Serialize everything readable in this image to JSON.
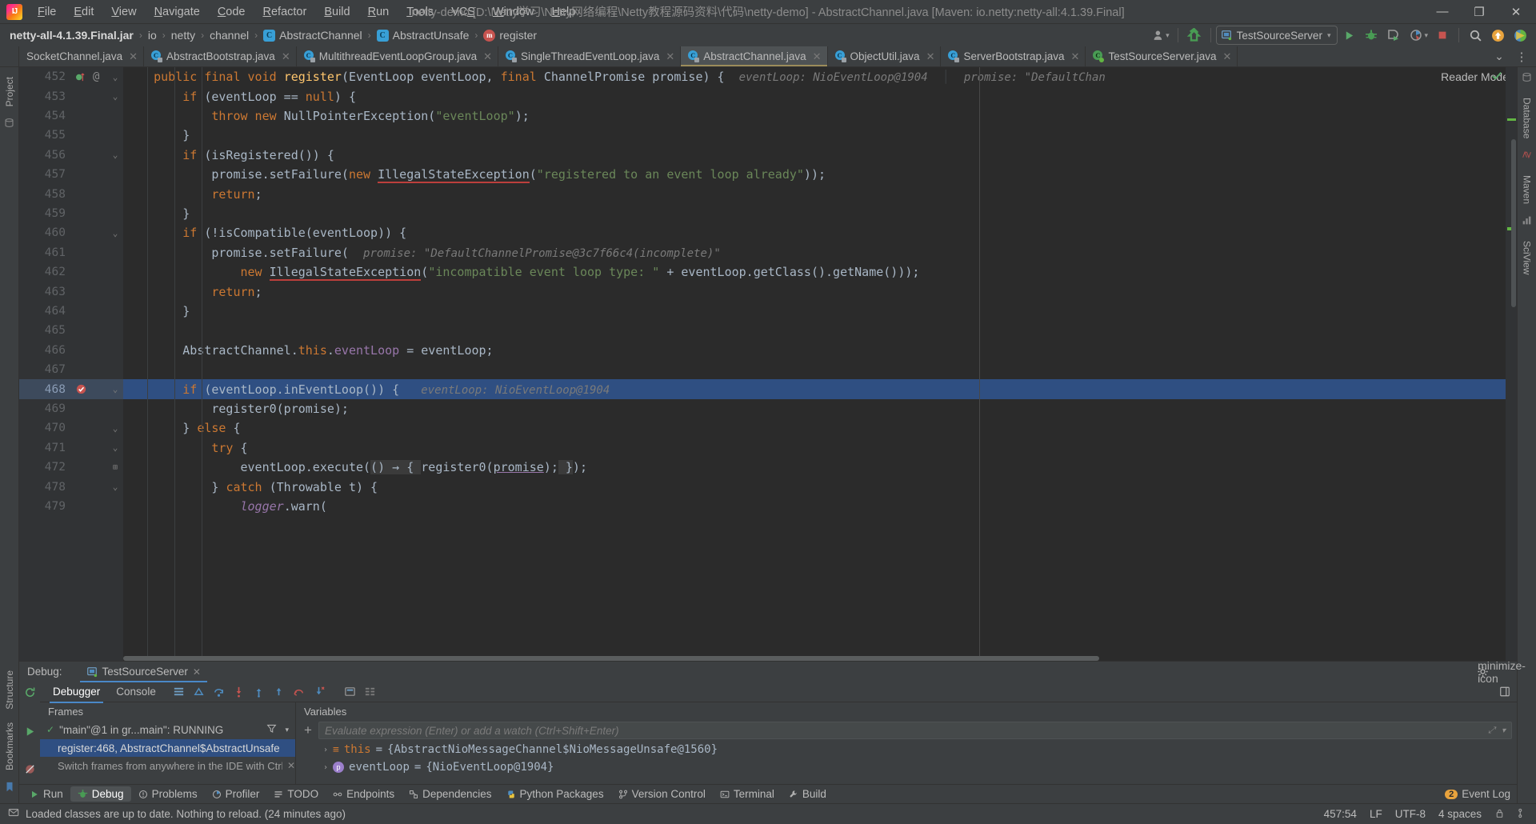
{
  "titlebar": {
    "logo": "ij-logo",
    "menus": [
      "File",
      "Edit",
      "View",
      "Navigate",
      "Code",
      "Refactor",
      "Build",
      "Run",
      "Tools",
      "VCS",
      "Window",
      "Help"
    ],
    "window_title": "netty-demo [D:\\Netty学习\\Netty网络编程\\Netty教程源码资料\\代码\\netty-demo] - AbstractChannel.java [Maven: io.netty:netty-all:4.1.39.Final]",
    "minimize": "—",
    "maximize": "❐",
    "close": "✕"
  },
  "breadcrumb": {
    "items": [
      {
        "label": "netty-all-4.1.39.Final.jar",
        "icon": "",
        "bold": true
      },
      {
        "label": "io",
        "icon": ""
      },
      {
        "label": "netty",
        "icon": ""
      },
      {
        "label": "channel",
        "icon": ""
      },
      {
        "label": "AbstractChannel",
        "icon": "class-icon"
      },
      {
        "label": "AbstractUnsafe",
        "icon": "class-icon"
      },
      {
        "label": "register",
        "icon": "method-icon"
      }
    ],
    "separator": "›"
  },
  "toolbar": {
    "account_icon": "user-icon",
    "account_chevron": "▾",
    "update_icon": "vcs-update-icon",
    "run_config_name": "TestSourceServer",
    "run_config_icon": "run-config-icon",
    "run_config_chevron": "▾",
    "run_icon": "run-icon",
    "debug_icon": "debug-icon",
    "run_coverage_icon": "run-coverage-icon",
    "profiler_icon": "profiler-icon",
    "profiler_chevron": "▾",
    "stop_icon": "stop-icon",
    "search_icon": "search-everywhere-icon",
    "ide_update_icon": "ide-update-icon",
    "colors_icon": "colors-icon"
  },
  "tabs": [
    {
      "label": "SocketChannel.java",
      "icon": "java-class-icon",
      "active": false,
      "close": "✕",
      "no_icon": true
    },
    {
      "label": "AbstractBootstrap.java",
      "icon": "java-class-icon",
      "active": false,
      "close": "✕"
    },
    {
      "label": "MultithreadEventLoopGroup.java",
      "icon": "java-class-icon",
      "active": false,
      "close": "✕"
    },
    {
      "label": "SingleThreadEventLoop.java",
      "icon": "java-class-icon",
      "active": false,
      "close": "✕"
    },
    {
      "label": "AbstractChannel.java",
      "icon": "java-class-icon",
      "active": true,
      "close": "✕"
    },
    {
      "label": "ObjectUtil.java",
      "icon": "java-class-icon",
      "active": false,
      "close": "✕"
    },
    {
      "label": "ServerBootstrap.java",
      "icon": "java-class-icon",
      "active": false,
      "close": "✕"
    },
    {
      "label": "TestSourceServer.java",
      "icon": "java-runnable-icon",
      "active": false,
      "close": "✕"
    }
  ],
  "tabs_overflow": {
    "chevron": "⌄",
    "more": "⋮"
  },
  "left_tool_buttons": [
    {
      "label": "Project",
      "name": "sidebar-item-project"
    },
    {
      "label": "Structure",
      "name": "sidebar-item-structure"
    },
    {
      "label": "Bookmarks",
      "name": "sidebar-item-bookmarks"
    }
  ],
  "right_tool_buttons": [
    {
      "label": "Database",
      "name": "sidebar-item-database"
    },
    {
      "label": "Maven",
      "name": "sidebar-item-maven"
    },
    {
      "label": "SciView",
      "name": "sidebar-item-sciview"
    }
  ],
  "editor": {
    "reader_mode_label": "Reader Mode",
    "highlighted_line": 468,
    "current_line_marker": "breakpoint-hit-icon",
    "lines": [
      {
        "n": "452",
        "indent": 0,
        "gmark": "bookmark-run-icon",
        "fold": "⌄",
        "at": "@"
      },
      {
        "n": "453",
        "indent": 0,
        "fold": "⌄"
      },
      {
        "n": "454",
        "indent": 0
      },
      {
        "n": "455",
        "indent": 0
      },
      {
        "n": "456",
        "indent": 0,
        "fold": "⌄"
      },
      {
        "n": "457",
        "indent": 0
      },
      {
        "n": "458",
        "indent": 0
      },
      {
        "n": "459",
        "indent": 0
      },
      {
        "n": "460",
        "indent": 0,
        "fold": "⌄"
      },
      {
        "n": "461",
        "indent": 0
      },
      {
        "n": "462",
        "indent": 0
      },
      {
        "n": "463",
        "indent": 0
      },
      {
        "n": "464",
        "indent": 0
      },
      {
        "n": "465",
        "indent": 0
      },
      {
        "n": "466",
        "indent": 0
      },
      {
        "n": "467",
        "indent": 0
      },
      {
        "n": "468",
        "indent": 0,
        "fold": "⌄"
      },
      {
        "n": "469",
        "indent": 0
      },
      {
        "n": "470",
        "indent": 0,
        "fold": "⌄"
      },
      {
        "n": "471",
        "indent": 0,
        "fold": "⌄"
      },
      {
        "n": "472",
        "indent": 0,
        "fold": "+"
      },
      {
        "n": "478",
        "indent": 0,
        "fold": "⌄"
      },
      {
        "n": "479",
        "indent": 0
      }
    ],
    "inlay_hints": [
      {
        "line": 452,
        "text": "eventLoop: NioEventLoop@1904"
      },
      {
        "line": 452,
        "text": "promise: \"DefaultChan"
      },
      {
        "line": 461,
        "text": "promise: \"DefaultChannelPromise@3c7f66c4(incomplete)\""
      },
      {
        "line": 468,
        "text": "eventLoop: NioEventLoop@1904"
      }
    ]
  },
  "debug": {
    "header_label": "Debug:",
    "session_name": "TestSourceServer",
    "session_close": "✕",
    "settings_icon": "gear-icon",
    "minimize_icon": "minimize-icon",
    "tabs": [
      {
        "label": "Debugger",
        "active": true
      },
      {
        "label": "Console",
        "active": false
      }
    ],
    "step_icons": [
      "frames-icon",
      "show-execution-point-icon",
      "step-over-icon",
      "step-into-icon",
      "force-step-into-icon",
      "step-out-icon",
      "drop-frame-icon",
      "run-to-cursor-icon",
      "evaluate-icon",
      "mute-breakpoints-icon"
    ],
    "layout_icon": "layout-settings-icon",
    "rerun_icon": "rerun-icon",
    "frames_header": "Frames",
    "thread_selector": "\"main\"@1 in gr...main\": RUNNING",
    "thread_filter_icon": "filter-icon",
    "thread_chevron": "▾",
    "thread_check": "✓",
    "frames": [
      {
        "label": "register:468, AbstractChannel$AbstractUnsafe",
        "selected": true
      },
      {
        "label": "Switch frames from anywhere in the IDE with Ctrl...",
        "selected": false,
        "hint": true,
        "close": "✕"
      }
    ],
    "variables_header": "Variables",
    "add_watch_icon": "+",
    "eval_placeholder": "Evaluate expression (Enter) or add a watch (Ctrl+Shift+Enter)",
    "eval_right_icons": [
      "expand-icon",
      "chevron-down-icon"
    ],
    "variables": [
      {
        "chev": "›",
        "badge": "≡",
        "badge_kind": "this",
        "name": "this",
        "eq": " = ",
        "value": "{AbstractNioMessageChannel$NioMessageUnsafe@1560}"
      },
      {
        "chev": "›",
        "badge": "p",
        "badge_kind": "param",
        "name": "eventLoop",
        "eq": " = ",
        "value": "{NioEventLoop@1904}"
      }
    ]
  },
  "bottom_toolbar": {
    "items": [
      {
        "label": "Run",
        "icon": "run-icon",
        "active": false
      },
      {
        "label": "Debug",
        "icon": "debug-icon",
        "active": true
      },
      {
        "label": "Problems",
        "icon": "problems-icon",
        "active": false
      },
      {
        "label": "Profiler",
        "icon": "profiler-icon",
        "active": false
      },
      {
        "label": "TODO",
        "icon": "todo-icon",
        "active": false
      },
      {
        "label": "Endpoints",
        "icon": "endpoints-icon",
        "active": false
      },
      {
        "label": "Dependencies",
        "icon": "dependencies-icon",
        "active": false
      },
      {
        "label": "Python Packages",
        "icon": "python-icon",
        "active": false
      },
      {
        "label": "Version Control",
        "icon": "vcs-icon",
        "active": false
      },
      {
        "label": "Terminal",
        "icon": "terminal-icon",
        "active": false
      },
      {
        "label": "Build",
        "icon": "build-icon",
        "active": false
      }
    ],
    "event_log": {
      "label": "Event Log",
      "count": "2",
      "icon": "event-log-icon"
    }
  },
  "status_bar": {
    "message_icon": "message-icon",
    "message": "Loaded classes are up to date. Nothing to reload. (24 minutes ago)",
    "caret_position": "457:54",
    "line_separator": "LF",
    "encoding": "UTF-8",
    "indent": "4 spaces",
    "lock_icon": "lock-icon",
    "branch_icon": "branch-icon"
  },
  "colors": {
    "accent_blue": "#4a88c7",
    "selection_blue": "#2f4f82",
    "keyword_orange": "#cc7832",
    "string_green": "#6a8759",
    "method_yellow": "#ffc66d",
    "field_purple": "#9876aa",
    "number_blue": "#6897bb",
    "text_gray": "#a9b7c6",
    "editor_bg": "#2b2b2b",
    "panel_bg": "#3c3f41",
    "gutter_bg": "#313335"
  }
}
